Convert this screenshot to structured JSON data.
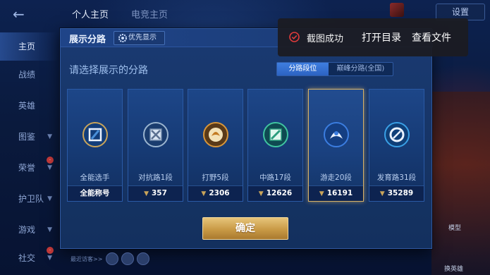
{
  "topnav": {
    "tabs": [
      {
        "label": "个人主页",
        "active": true
      },
      {
        "label": "电竞主页",
        "active": false
      }
    ],
    "settings_label": "设置"
  },
  "sidebar": {
    "items": [
      {
        "label": "主页",
        "active": true
      },
      {
        "label": "战绩"
      },
      {
        "label": "英雄"
      },
      {
        "label": "图鉴"
      },
      {
        "label": "荣誉"
      },
      {
        "label": "护卫队"
      },
      {
        "label": "游戏"
      },
      {
        "label": "社交"
      }
    ]
  },
  "modal": {
    "title": "展示分路",
    "pref_button": "优先显示",
    "subtitle": "请选择展示的分路",
    "segments": [
      {
        "label": "分路段位",
        "active": true
      },
      {
        "label": "巅峰分路(全国)",
        "active": false
      }
    ],
    "cards": [
      {
        "name": "全能选手",
        "footer": "全能称号",
        "selected": false,
        "color": "#4a8fd8"
      },
      {
        "name": "对抗路1段",
        "footer": "357",
        "selected": false,
        "color": "#9ab4cf"
      },
      {
        "name": "打野5段",
        "footer": "2306",
        "selected": false,
        "color": "#d8963a"
      },
      {
        "name": "中路17段",
        "footer": "12626",
        "selected": false,
        "color": "#3fc4a0"
      },
      {
        "name": "游走20段",
        "footer": "16191",
        "selected": true,
        "color": "#3b7de0"
      },
      {
        "name": "发育路31段",
        "footer": "35289",
        "selected": false,
        "color": "#3aa0e6"
      }
    ],
    "confirm_label": "确定"
  },
  "toast": {
    "message": "截图成功",
    "open_dir": "打开目录",
    "view_file": "查看文件"
  },
  "bottom": {
    "visitor_text": "最近访客>>"
  },
  "right_panel": {
    "model_label": "模型",
    "hero_label": "换英雄"
  },
  "colors": {
    "accent_gold": "#d8b266",
    "active_tab_blue": "#3f7ee0"
  }
}
